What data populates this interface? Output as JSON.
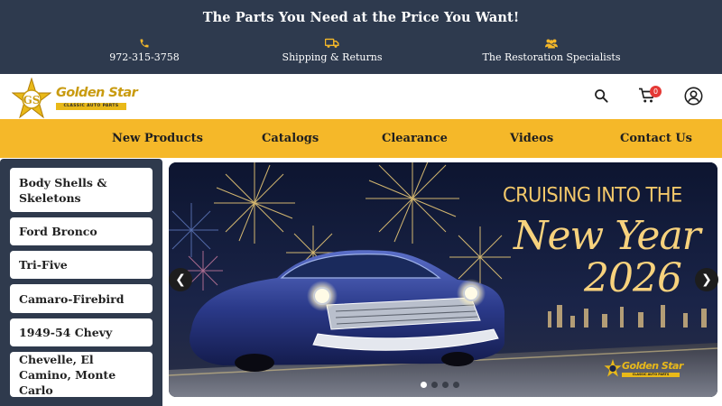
{
  "topbar": {
    "tagline": "The Parts You Need at the Price You Want!",
    "phone": "972-315-3758",
    "shipping": "Shipping & Returns",
    "restoration": "The Restoration Specialists"
  },
  "header": {
    "logo_text": "Golden Star",
    "logo_sub": "CLASSIC AUTO PARTS",
    "cart_count": "0"
  },
  "nav": {
    "items": [
      "New Products",
      "Catalogs",
      "Clearance",
      "Videos",
      "Contact Us"
    ]
  },
  "sidebar": {
    "items": [
      "Body Shells & Skeletons",
      "Ford Bronco",
      "Tri-Five",
      "Camaro-Firebird",
      "1949-54 Chevy",
      "Chevelle, El Camino, Monte Carlo"
    ]
  },
  "hero": {
    "line1": "CRUISING INTO THE",
    "line2": "New Year",
    "line3": "2026",
    "logo_text": "Golden Star",
    "logo_sub": "CLASSIC AUTO PARTS",
    "prev": "❮",
    "next": "❯",
    "slide_count": 4,
    "active_slide": 1
  },
  "colors": {
    "topbar": "#2e3a4e",
    "nav": "#f5b829",
    "badge": "#e53935"
  },
  "icons": {
    "phone": "phone-icon",
    "shipping": "truck-icon",
    "restoration": "people-icon",
    "search": "search-icon",
    "cart": "cart-icon",
    "account": "user-icon"
  }
}
